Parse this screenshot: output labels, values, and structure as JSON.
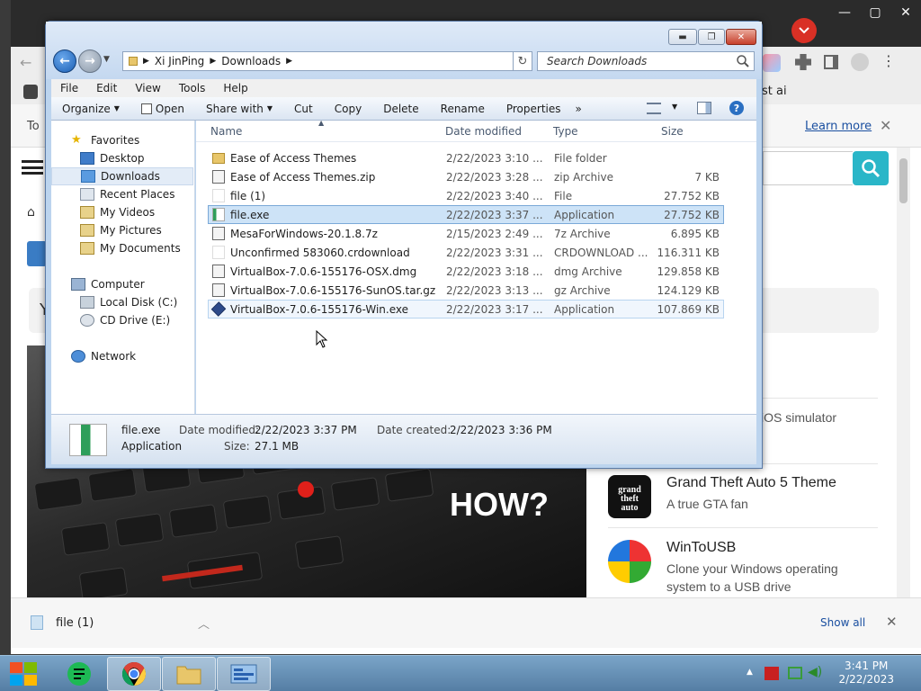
{
  "browser": {
    "bookmark_partial": "st ai",
    "infobar": {
      "left_text": "To",
      "learn_more": "Learn more"
    },
    "search_partial": "",
    "grey_card_letter": "Y",
    "hero_text": "HOW?",
    "cards": [
      {
        "title": "",
        "subtitle": "iOS simulator"
      },
      {
        "title": "Grand Theft Auto 5 Theme",
        "subtitle": "A true GTA fan"
      },
      {
        "title": "WinToUSB",
        "subtitle": "Clone your Windows operating",
        "subtitle2": "system to a USB drive"
      }
    ],
    "download": {
      "filename": "file (1)",
      "show_all": "Show all"
    }
  },
  "explorer": {
    "address": {
      "crumbs": [
        "Xi JinPing",
        "Downloads"
      ]
    },
    "search_placeholder": "Search Downloads",
    "menu": [
      "File",
      "Edit",
      "View",
      "Tools",
      "Help"
    ],
    "commands": [
      "Organize",
      "Open",
      "Share with",
      "Cut",
      "Copy",
      "Delete",
      "Rename",
      "Properties",
      "»"
    ],
    "nav": {
      "favorites": "Favorites",
      "items": [
        "Desktop",
        "Downloads",
        "Recent Places",
        "My Videos",
        "My Pictures",
        "My Documents"
      ],
      "computer": "Computer",
      "drives": [
        "Local Disk (C:)",
        "CD Drive (E:)"
      ],
      "network": "Network"
    },
    "columns": {
      "name": "Name",
      "date": "Date modified",
      "type": "Type",
      "size": "Size"
    },
    "files": [
      {
        "name": "Ease of Access Themes",
        "date": "2/22/2023 3:10 ...",
        "type": "File folder",
        "size": "",
        "icon": "folder-icon"
      },
      {
        "name": "Ease of Access Themes.zip",
        "date": "2/22/2023 3:28 ...",
        "type": "zip Archive",
        "size": "7 KB",
        "icon": "zip-icon"
      },
      {
        "name": "file (1)",
        "date": "2/22/2023 3:40 ...",
        "type": "File",
        "size": "27.752 KB",
        "icon": "blank-file-icon"
      },
      {
        "name": "file.exe",
        "date": "2/22/2023 3:37 ...",
        "type": "Application",
        "size": "27.752 KB",
        "icon": "exe-icon"
      },
      {
        "name": "MesaForWindows-20.1.8.7z",
        "date": "2/15/2023 2:49 ...",
        "type": "7z Archive",
        "size": "6.895 KB",
        "icon": "7z-icon"
      },
      {
        "name": "Unconfirmed 583060.crdownload",
        "date": "2/22/2023 3:31 ...",
        "type": "CRDOWNLOAD ...",
        "size": "116.311 KB",
        "icon": "blank-file-icon"
      },
      {
        "name": "VirtualBox-7.0.6-155176-OSX.dmg",
        "date": "2/22/2023 3:18 ...",
        "type": "dmg Archive",
        "size": "129.858 KB",
        "icon": "dmg-icon"
      },
      {
        "name": "VirtualBox-7.0.6-155176-SunOS.tar.gz",
        "date": "2/22/2023 3:13 ...",
        "type": "gz Archive",
        "size": "124.129 KB",
        "icon": "gz-icon"
      },
      {
        "name": "VirtualBox-7.0.6-155176-Win.exe",
        "date": "2/22/2023 3:17 ...",
        "type": "Application",
        "size": "107.869 KB",
        "icon": "virtualbox-icon"
      }
    ],
    "details": {
      "name": "file.exe",
      "kind": "Application",
      "date_modified_label": "Date modified:",
      "date_modified": "2/22/2023 3:37 PM",
      "date_created_label": "Date created:",
      "date_created": "2/22/2023 3:36 PM",
      "size_label": "Size:",
      "size": "27.1 MB"
    }
  },
  "taskbar": {
    "time": "3:41 PM",
    "date": "2/22/2023"
  }
}
